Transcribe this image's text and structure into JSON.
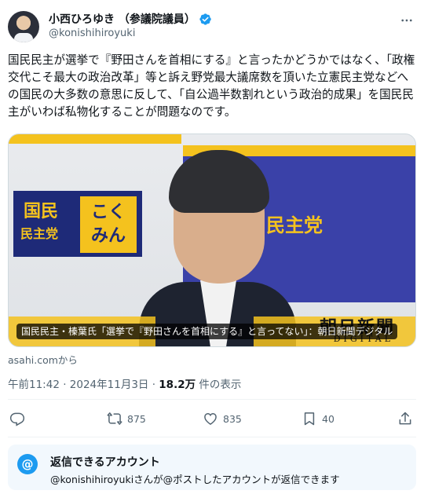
{
  "post": {
    "author": {
      "display_name": "小西ひろゆき （参議院議員）",
      "handle": "@konishihiroyuki",
      "verified": true
    },
    "text": "国民民主が選挙で『野田さんを首相にする』と言ったかどうかではなく、「政権交代こそ最大の政治改革」等と訴え野党最大議席数を頂いた立憲民主党などへの国民の大多数の意思に反して、「自公過半数割れという政治的成果」を国民民主がいわば私物化することが問題なのです。",
    "link_card": {
      "logo_left_line1": "国民",
      "logo_left_line2": "民主党",
      "logo_right_line1": "こく",
      "logo_right_line2": "みん",
      "panel_text": "民主党",
      "watermark": "朝日新聞",
      "watermark_sub": "DIGITAL",
      "caption": "国民民主・榛葉氏「選挙で『野田さんを首相にする』と言ってない」：朝日新聞デジタル"
    },
    "source": "asahi.comから",
    "timestamp": "午前11:42 · 2024年11月3日 · ",
    "views_count": "18.2万",
    "views_label": " 件の表示"
  },
  "actions": {
    "reply_count": "",
    "repost_count": "875",
    "like_count": "835",
    "bookmark_count": "40"
  },
  "reply_settings": {
    "title": "返信できるアカウント",
    "description": "@konishihiroyukiさんが@ポストしたアカウントが返信できます",
    "icon_text": "@"
  },
  "colors": {
    "accent": "#1d9bf0",
    "text_primary": "#0f1419",
    "text_secondary": "#536471",
    "reply_box_bg": "#f2f8fd"
  }
}
